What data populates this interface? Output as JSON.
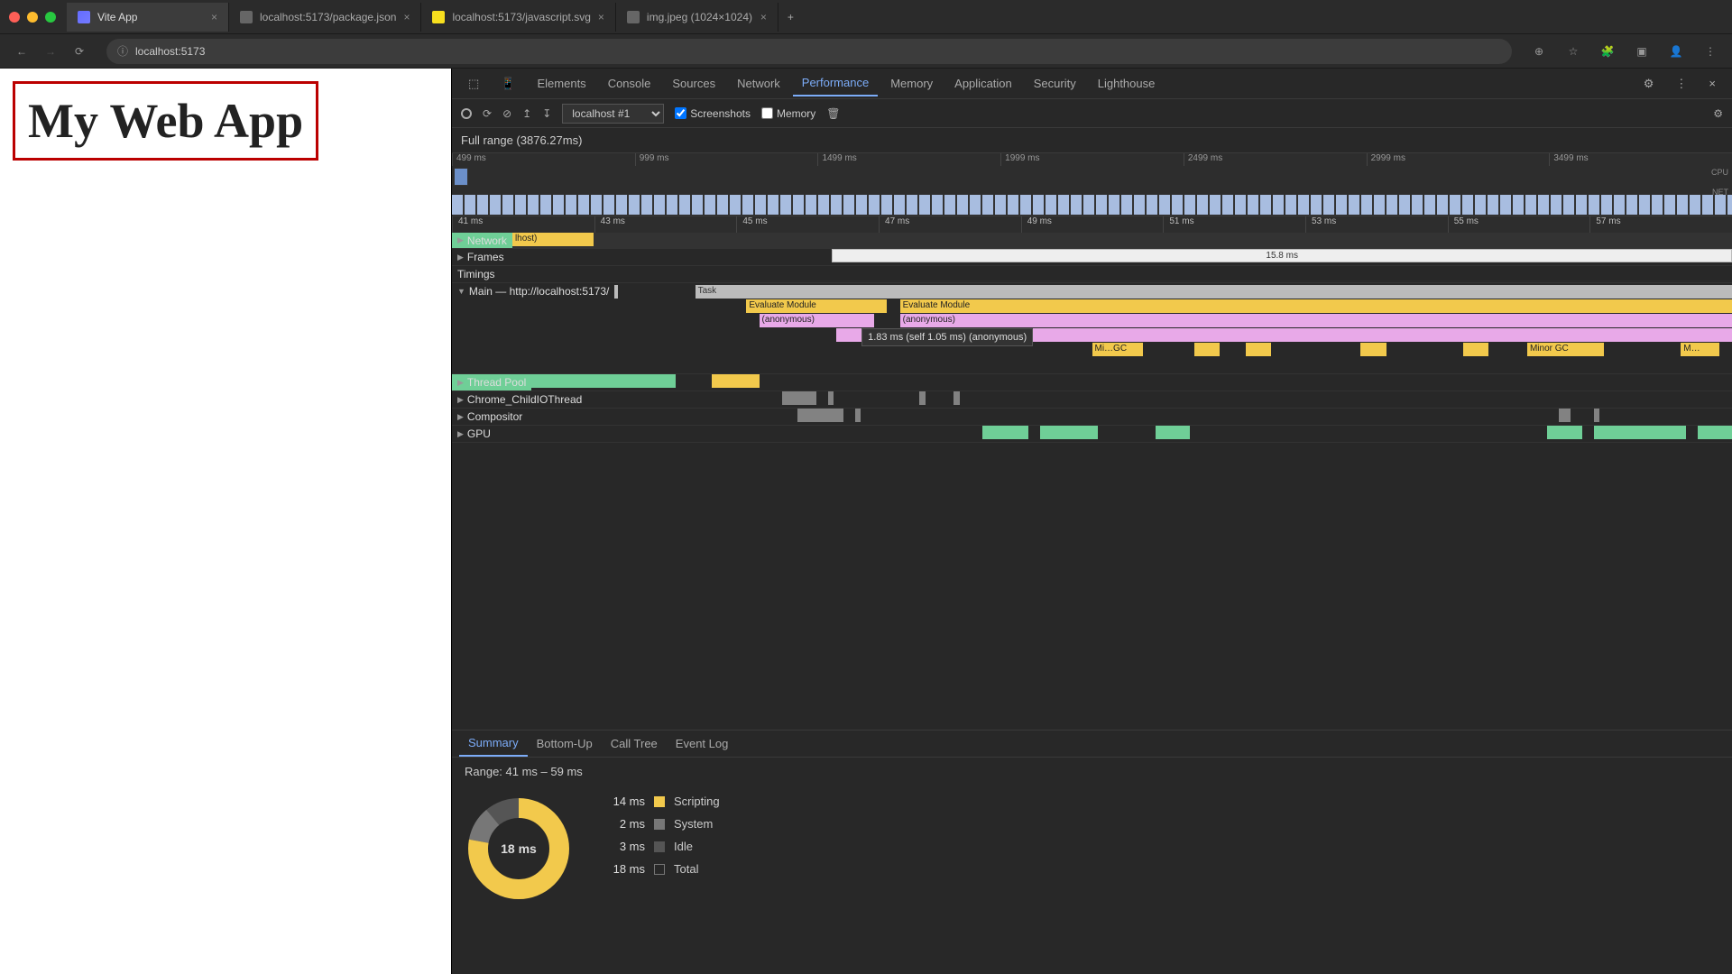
{
  "browser": {
    "tabs": [
      {
        "label": "Vite App",
        "active": true
      },
      {
        "label": "localhost:5173/package.json",
        "active": false
      },
      {
        "label": "localhost:5173/javascript.svg",
        "active": false
      },
      {
        "label": "img.jpeg (1024×1024)",
        "active": false
      }
    ],
    "url": "localhost:5173"
  },
  "page": {
    "heading": "My Web App"
  },
  "devtools": {
    "panels": [
      "Elements",
      "Console",
      "Sources",
      "Network",
      "Performance",
      "Memory",
      "Application",
      "Security",
      "Lighthouse"
    ],
    "active_panel": "Performance",
    "toolbar": {
      "recording_select": "localhost #1",
      "screenshots_label": "Screenshots",
      "memory_label": "Memory",
      "screenshots_checked": true,
      "memory_checked": false
    },
    "full_range": "Full range (3876.27ms)",
    "overview_ticks": [
      "499 ms",
      "999 ms",
      "1499 ms",
      "1999 ms",
      "2499 ms",
      "2999 ms",
      "3499 ms"
    ],
    "overview_labels": {
      "cpu": "CPU",
      "net": "NET"
    },
    "ruler_ticks": [
      "41 ms",
      "43 ms",
      "45 ms",
      "47 ms",
      "49 ms",
      "51 ms",
      "53 ms",
      "55 ms",
      "57 ms"
    ],
    "tracks": {
      "network": "Network",
      "network_val": "lhost)",
      "frames": "Frames",
      "frames_val": "15.8 ms",
      "timings": "Timings",
      "main": "Main — http://localhost:5173/",
      "thread_pool": "Thread Pool",
      "chrome_io": "Chrome_ChildIOThread",
      "compositor": "Compositor",
      "gpu": "GPU"
    },
    "flame": {
      "task": "Task",
      "eval_module": "Evaluate Module",
      "anonymous": "(anonymous)",
      "minor_gc": "Minor GC",
      "minor_gc_short": "Mi…GC",
      "m_short": "M…",
      "tooltip": "1.83 ms (self 1.05 ms)  (anonymous)"
    },
    "bottom_tabs": [
      "Summary",
      "Bottom-Up",
      "Call Tree",
      "Event Log"
    ],
    "bottom_active": "Summary",
    "summary": {
      "range": "Range: 41 ms – 59 ms",
      "total": "18 ms",
      "rows": [
        {
          "val": "14 ms",
          "label": "Scripting",
          "color": "#f2c94c"
        },
        {
          "val": "2 ms",
          "label": "System",
          "color": "#777"
        },
        {
          "val": "3 ms",
          "label": "Idle",
          "color": "#555"
        },
        {
          "val": "18 ms",
          "label": "Total",
          "color": "transparent"
        }
      ]
    }
  },
  "chart_data": {
    "type": "pie",
    "title": "Range: 41 ms – 59 ms",
    "categories": [
      "Scripting",
      "System",
      "Idle"
    ],
    "values": [
      14,
      2,
      3
    ],
    "total": 18,
    "unit": "ms"
  }
}
